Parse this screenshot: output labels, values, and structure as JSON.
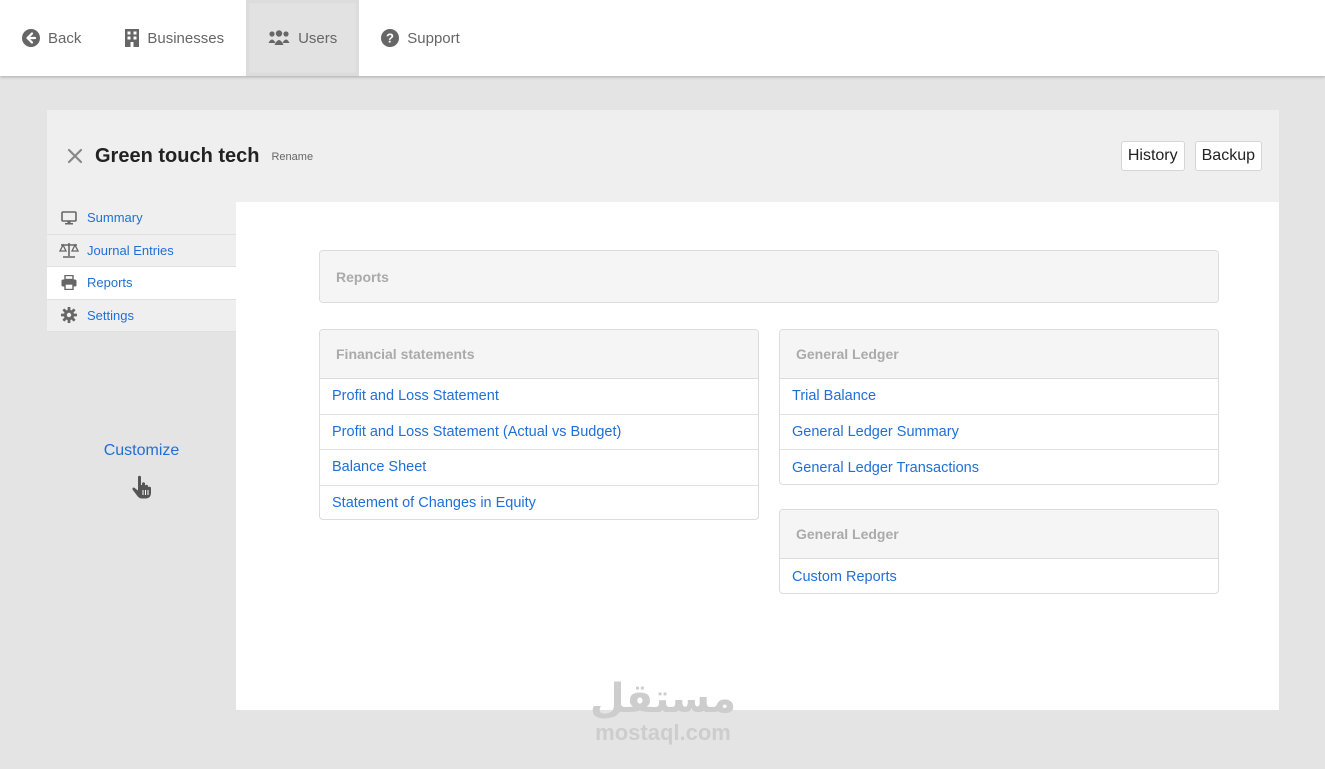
{
  "nav": {
    "back": "Back",
    "businesses": "Businesses",
    "users": "Users",
    "support": "Support"
  },
  "business": {
    "name": "Green touch tech",
    "rename": "Rename",
    "history": "History",
    "backup": "Backup"
  },
  "sidebar": {
    "items": [
      {
        "label": "Summary",
        "icon": "monitor-icon"
      },
      {
        "label": "Journal Entries",
        "icon": "scales-icon"
      },
      {
        "label": "Reports",
        "icon": "printer-icon",
        "active": true
      },
      {
        "label": "Settings",
        "icon": "gear-icon"
      }
    ],
    "customize": "Customize"
  },
  "reports": {
    "title": "Reports",
    "financial": {
      "title": "Financial statements",
      "items": [
        "Profit and Loss Statement",
        "Profit and Loss Statement (Actual vs Budget)",
        "Balance Sheet",
        "Statement of Changes in Equity"
      ]
    },
    "ledger": {
      "title": "General Ledger",
      "items": [
        "Trial Balance",
        "General Ledger Summary",
        "General Ledger Transactions"
      ]
    },
    "custom": {
      "title": "General Ledger",
      "items": [
        "Custom Reports"
      ]
    }
  },
  "watermark": {
    "arabic": "مستقل",
    "latin": "mostaql.com"
  },
  "colors": {
    "link": "#1f6fd6",
    "panel_header": "#efefef",
    "background": "#e4e4e4"
  }
}
